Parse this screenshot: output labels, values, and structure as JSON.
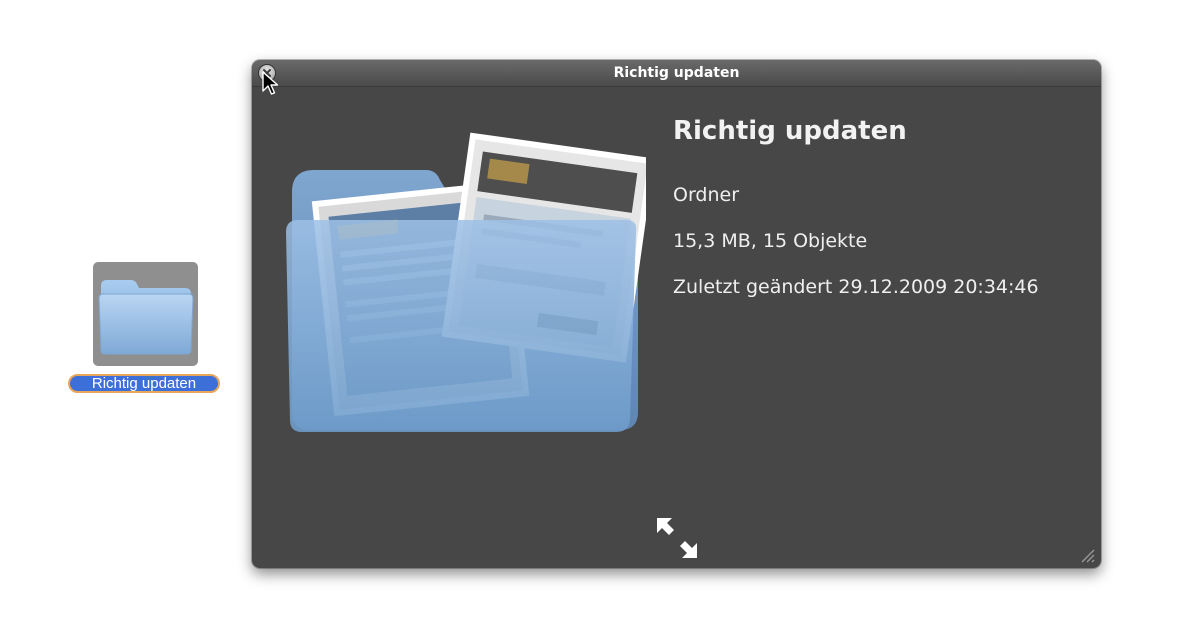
{
  "desktop": {
    "folder_label": "Richtig updaten",
    "folder_icon": "folder-icon"
  },
  "quicklook": {
    "window_title": "Richtig updaten",
    "close_icon": "close-icon",
    "fullscreen_icon": "fullscreen-expand-icon",
    "resize_icon": "resize-grip-icon",
    "info": {
      "name": "Richtig updaten",
      "kind": "Ordner",
      "size_and_count": "15,3 MB, 15 Objekte",
      "modified": "Zuletzt geändert 29.12.2009 20:34:46"
    }
  },
  "colors": {
    "window_background": "#474747",
    "label_selection": "#3d6fd8",
    "label_outline": "#e8a65a",
    "folder_blue": "#9ec4ea"
  }
}
